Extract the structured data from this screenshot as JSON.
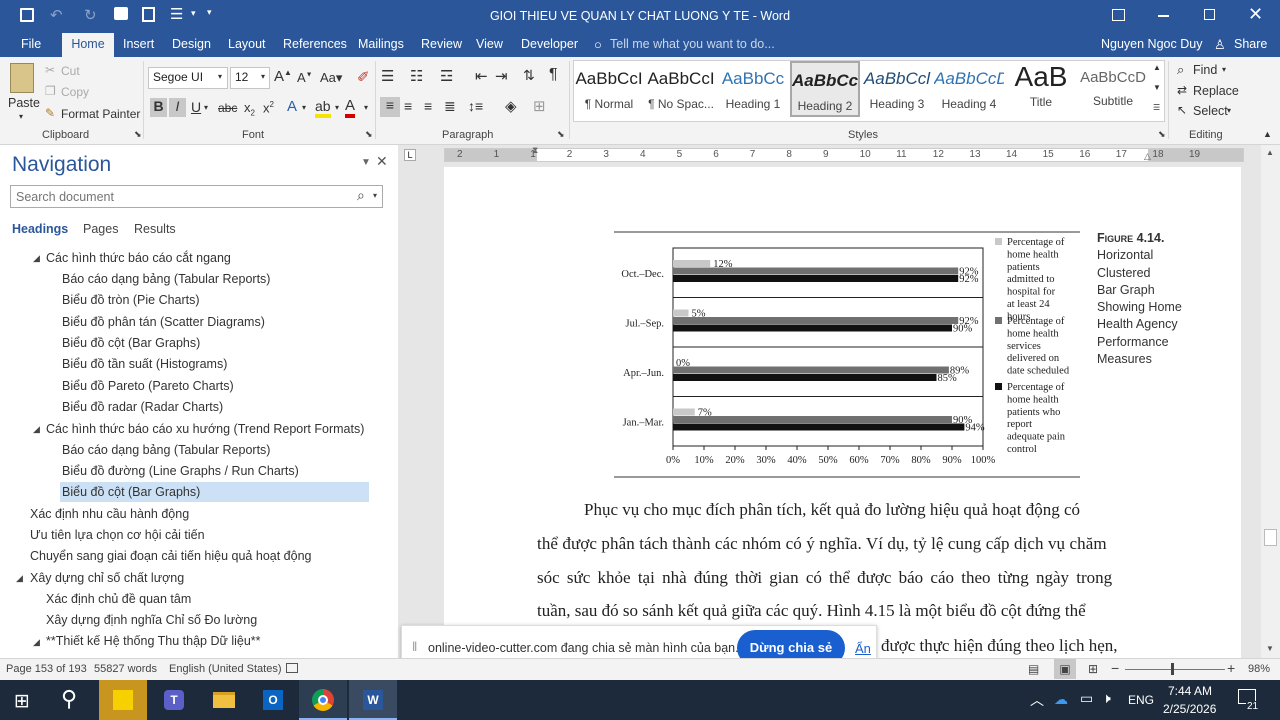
{
  "window": {
    "title": "GIOI THIEU VE QUAN LY CHAT LUONG Y TE - Word"
  },
  "tabs": [
    "File",
    "Home",
    "Insert",
    "Design",
    "Layout",
    "References",
    "Mailings",
    "Review",
    "View",
    "Developer"
  ],
  "tell_me": "Tell me what you want to do...",
  "user": {
    "name": "Nguyen Ngoc Duy",
    "share": "Share"
  },
  "clipboard": {
    "paste": "Paste",
    "cut": "Cut",
    "copy": "Copy",
    "format_painter": "Format Painter",
    "label": "Clipboard"
  },
  "font": {
    "name": "Segoe UI",
    "size": "12",
    "label": "Font"
  },
  "paragraph": {
    "label": "Paragraph"
  },
  "styles": {
    "label": "Styles",
    "items": [
      {
        "preview": "AaBbCcI",
        "name": "¶ Normal"
      },
      {
        "preview": "AaBbCcI",
        "name": "¶ No Spac..."
      },
      {
        "preview": "AaBbCc",
        "name": "Heading 1"
      },
      {
        "preview": "AaBbCcl",
        "name": "Heading 2"
      },
      {
        "preview": "AaBbCcl",
        "name": "Heading 3"
      },
      {
        "preview": "AaBbCcD",
        "name": "Heading 4"
      },
      {
        "preview": "AaB",
        "name": "Title"
      },
      {
        "preview": "AaBbCcD",
        "name": "Subtitle"
      }
    ]
  },
  "editing": {
    "find": "Find",
    "replace": "Replace",
    "select": "Select",
    "label": "Editing"
  },
  "navigation": {
    "title": "Navigation",
    "search_placeholder": "Search document",
    "tabs": [
      "Headings",
      "Pages",
      "Results"
    ],
    "items": [
      {
        "label": "Các hình thức báo cáo cắt ngang"
      },
      {
        "label": "Báo cáo dạng bảng (Tabular Reports)"
      },
      {
        "label": "Biểu đồ tròn (Pie Charts)"
      },
      {
        "label": "Biểu đồ phân tán (Scatter Diagrams)"
      },
      {
        "label": "Biểu đồ cột (Bar Graphs)"
      },
      {
        "label": "Biểu đồ tần suất (Histograms)"
      },
      {
        "label": "Biểu đồ Pareto (Pareto Charts)"
      },
      {
        "label": "Biểu đồ radar (Radar Charts)"
      },
      {
        "label": "Các hình thức báo cáo xu hướng (Trend Report Formats)"
      },
      {
        "label": "Báo cáo dạng bảng (Tabular Reports)"
      },
      {
        "label": "Biểu đồ đường (Line Graphs / Run Charts)"
      },
      {
        "label": "Biểu đồ cột (Bar Graphs)"
      },
      {
        "label": "Xác định nhu cầu hành động"
      },
      {
        "label": "Ưu tiên lựa chọn cơ hội cải tiến"
      },
      {
        "label": "Chuyển sang giai đoạn cải tiến hiệu quả hoạt động"
      },
      {
        "label": "Xây dựng chỉ số chất lượng"
      },
      {
        "label": "Xác định chủ đề quan tâm"
      },
      {
        "label": "Xây dựng định nghĩa Chỉ số Đo lường"
      },
      {
        "label": "**Thiết kế Hệ thống Thu thập Dữ liệu**"
      }
    ]
  },
  "ruler": {
    "ticks": [
      "2",
      "1",
      "1",
      "2",
      "3",
      "4",
      "5",
      "6",
      "7",
      "8",
      "9",
      "10",
      "11",
      "12",
      "13",
      "14",
      "15",
      "16",
      "17",
      "18",
      "19"
    ]
  },
  "figure": {
    "caption_label": "Figure 4.14.",
    "caption_lines": [
      "Horizontal",
      "Clustered",
      "Bar Graph",
      "Showing Home",
      "Health Agency",
      "Performance",
      "Measures"
    ]
  },
  "chart_data": {
    "type": "bar",
    "orientation": "horizontal",
    "categories": [
      "Oct.–Dec.",
      "Jul.–Sep.",
      "Apr.–Jun.",
      "Jan.–Mar."
    ],
    "series": [
      {
        "name": "Percentage of home health patients admitted to hospital for at least 24 hours",
        "color": "#c8c8c8",
        "values": [
          12,
          5,
          0,
          7
        ]
      },
      {
        "name": "Percentage of home health services delivered on date scheduled",
        "color": "#707070",
        "values": [
          92,
          92,
          89,
          90
        ]
      },
      {
        "name": "Percentage of home health patients who report adequate pain control",
        "color": "#111111",
        "values": [
          92,
          90,
          85,
          94
        ]
      }
    ],
    "x_ticks": [
      "0%",
      "10%",
      "20%",
      "30%",
      "40%",
      "50%",
      "60%",
      "70%",
      "80%",
      "90%",
      "100%"
    ],
    "xlim": [
      0,
      100
    ],
    "legend_position": "right"
  },
  "body_lines": [
    "Phục vụ cho mục đích phân tích, kết quả đo lường hiệu quả hoạt động có",
    "thể được phân tách thành các nhóm có ý nghĩa. Ví dụ, tỷ lệ cung cấp dịch vụ chăm",
    "sóc sức khỏe tại nhà đúng thời gian có thể được báo cáo theo từng ngày trong",
    "tuần, sau đó so sánh kết quả giữa các quý. Hình 4.15 là một biểu đồ cột đứng thể",
    "được thực hiện đúng theo lịch hẹn,"
  ],
  "share_bar": {
    "text": "online-video-cutter.com đang chia sẻ màn hình của bạn.",
    "stop": "Dừng chia sẻ",
    "hide": "Ẩn"
  },
  "status": {
    "page": "Page 153 of 193",
    "words": "55827 words",
    "language": "English (United States)",
    "zoom": "98%"
  },
  "taskbar": {
    "lang": "ENG",
    "time": "7:44 AM",
    "date": "2/25/2026",
    "notif": "21"
  }
}
